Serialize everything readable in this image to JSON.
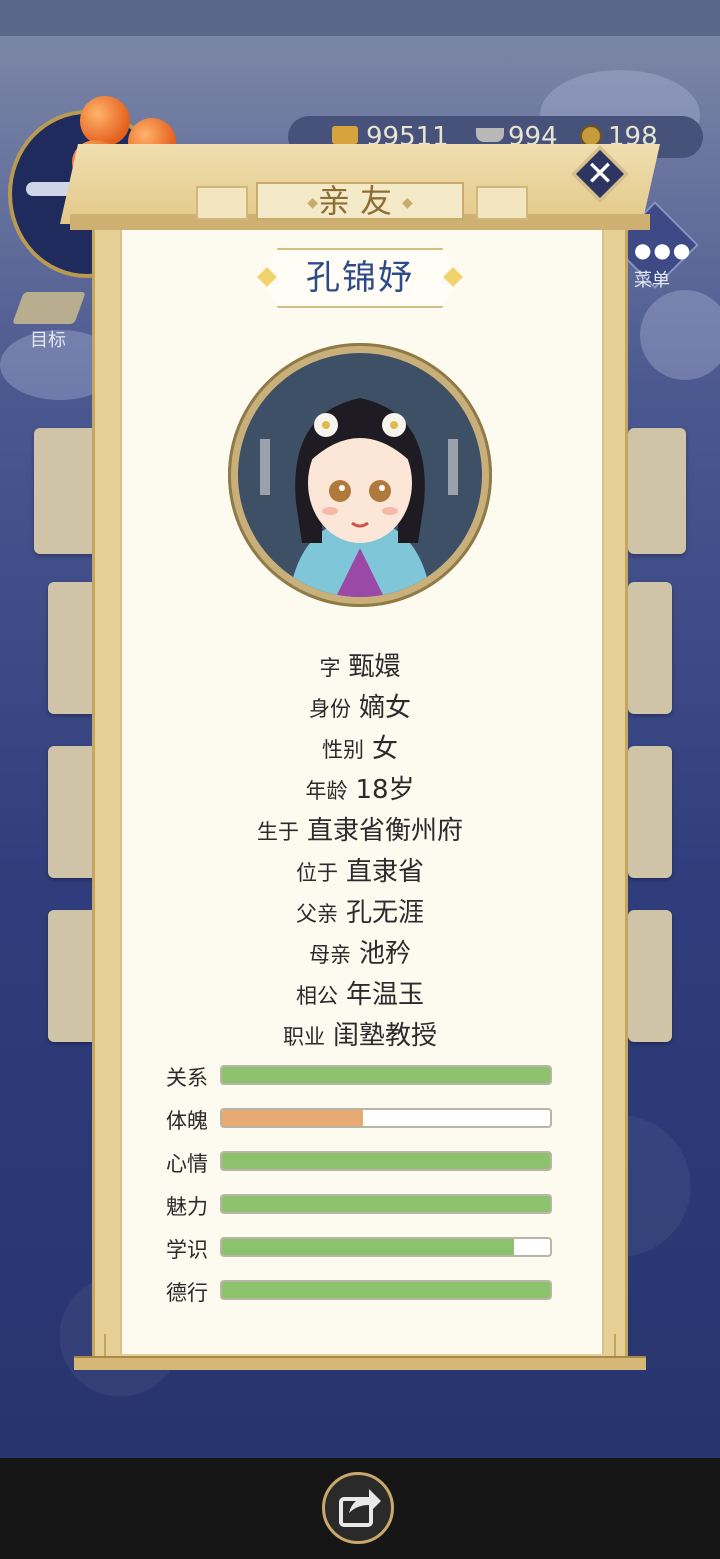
{
  "resources": {
    "gold": "99511",
    "silver": "994",
    "coins": "198"
  },
  "hud": {
    "menu_label": "菜单",
    "target_label": "目标"
  },
  "dialog": {
    "title": "亲友",
    "name": "孔锦妤"
  },
  "info": [
    {
      "key": "字",
      "value": "甄嬛"
    },
    {
      "key": "身份",
      "value": "嫡女"
    },
    {
      "key": "性别",
      "value": "女"
    },
    {
      "key": "年龄",
      "value": "18岁"
    },
    {
      "key": "生于",
      "value": "直隶省衡州府"
    },
    {
      "key": "位于",
      "value": "直隶省"
    },
    {
      "key": "父亲",
      "value": "孔无涯"
    },
    {
      "key": "母亲",
      "value": "池矜"
    },
    {
      "key": "相公",
      "value": "年温玉"
    },
    {
      "key": "职业",
      "value": "闺塾教授"
    }
  ],
  "stats": [
    {
      "label": "关系",
      "fill": 1.0,
      "color": "#8cc26b"
    },
    {
      "label": "体魄",
      "fill": 0.43,
      "color": "#e6aa72"
    },
    {
      "label": "心情",
      "fill": 1.0,
      "color": "#8cc26b"
    },
    {
      "label": "魅力",
      "fill": 1.0,
      "color": "#8cc26b"
    },
    {
      "label": "学识",
      "fill": 0.89,
      "color": "#8cc26b"
    },
    {
      "label": "德行",
      "fill": 1.0,
      "color": "#8cc26b"
    }
  ],
  "icons": {
    "close": "close-icon",
    "share": "share-icon",
    "portrait": "character-portrait"
  }
}
